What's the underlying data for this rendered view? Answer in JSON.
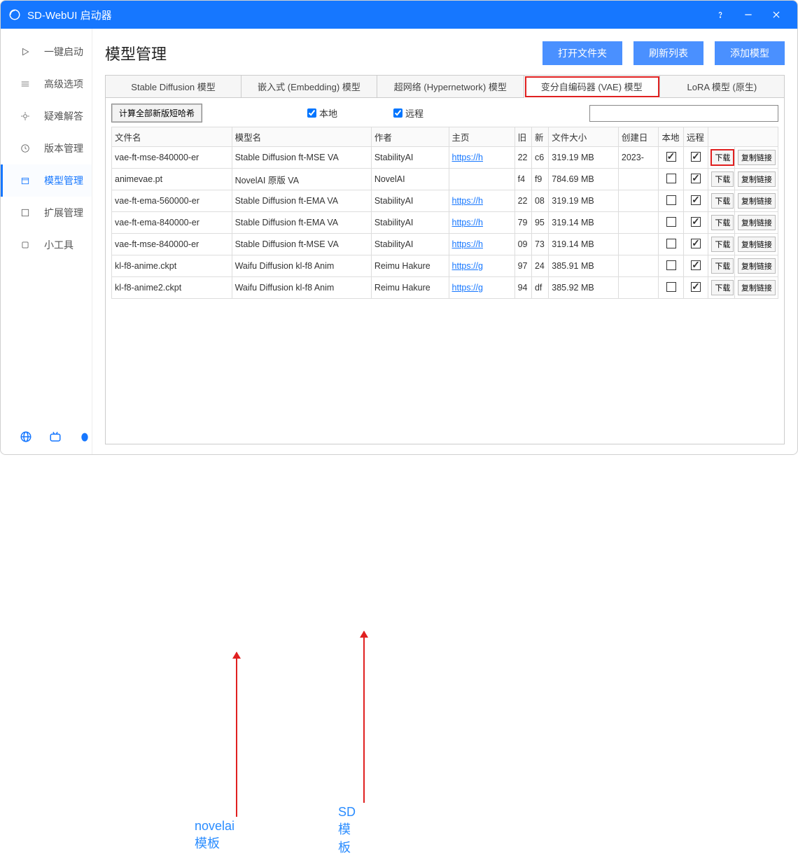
{
  "app": {
    "title": "SD-WebUI 启动器"
  },
  "sidebar": {
    "items": [
      {
        "label": "一键启动"
      },
      {
        "label": "高级选项"
      },
      {
        "label": "疑难解答"
      },
      {
        "label": "版本管理"
      },
      {
        "label": "模型管理"
      },
      {
        "label": "扩展管理"
      },
      {
        "label": "小工具"
      }
    ]
  },
  "header": {
    "title": "模型管理",
    "btn_open": "打开文件夹",
    "btn_refresh": "刷新列表",
    "btn_add": "添加模型"
  },
  "tabs": [
    {
      "label": "Stable Diffusion 模型"
    },
    {
      "label": "嵌入式 (Embedding) 模型"
    },
    {
      "label": "超网络 (Hypernetwork) 模型"
    },
    {
      "label": "变分自编码器 (VAE) 模型"
    },
    {
      "label": "LoRA 模型 (原生)"
    }
  ],
  "toolbar": {
    "hash_btn": "计算全部新版短哈希",
    "local_label": "本地",
    "remote_label": "远程",
    "search_placeholder": ""
  },
  "columns": {
    "filename": "文件名",
    "modelname": "模型名",
    "author": "作者",
    "homepage": "主页",
    "c5": "旧",
    "c6": "新",
    "filesize": "文件大小",
    "created": "创建日",
    "local": "本地",
    "remote": "远程",
    "actions": ""
  },
  "btn_download": "下载",
  "btn_copy": "复制链接",
  "rows": [
    {
      "filename": "vae-ft-mse-840000-er",
      "modelname": "Stable Diffusion ft-MSE VA",
      "author": "StabilityAI",
      "homepage": "https://h",
      "c5": "22",
      "c6": "c6",
      "size": "319.19 MB",
      "created": "2023-",
      "local": true,
      "remote": true,
      "dl_hl": true
    },
    {
      "filename": "animevae.pt",
      "modelname": "NovelAI 原版 VA",
      "author": "NovelAI",
      "homepage": "",
      "c5": "f4",
      "c6": "f9",
      "size": "784.69 MB",
      "created": "",
      "local": false,
      "remote": true,
      "dl_hl": false
    },
    {
      "filename": "vae-ft-ema-560000-er",
      "modelname": "Stable Diffusion ft-EMA VA",
      "author": "StabilityAI",
      "homepage": "https://h",
      "c5": "22",
      "c6": "08",
      "size": "319.19 MB",
      "created": "",
      "local": false,
      "remote": true,
      "dl_hl": false
    },
    {
      "filename": "vae-ft-ema-840000-er",
      "modelname": "Stable Diffusion ft-EMA VA",
      "author": "StabilityAI",
      "homepage": "https://h",
      "c5": "79",
      "c6": "95",
      "size": "319.14 MB",
      "created": "",
      "local": false,
      "remote": true,
      "dl_hl": false
    },
    {
      "filename": "vae-ft-mse-840000-er",
      "modelname": "Stable Diffusion ft-MSE VA",
      "author": "StabilityAI",
      "homepage": "https://h",
      "c5": "09",
      "c6": "73",
      "size": "319.14 MB",
      "created": "",
      "local": false,
      "remote": true,
      "dl_hl": false
    },
    {
      "filename": "kl-f8-anime.ckpt",
      "modelname": "Waifu Diffusion kl-f8 Anim",
      "author": "Reimu Hakure",
      "homepage": "https://g",
      "c5": "97",
      "c6": "24",
      "size": "385.91 MB",
      "created": "",
      "local": false,
      "remote": true,
      "dl_hl": false
    },
    {
      "filename": "kl-f8-anime2.ckpt",
      "modelname": "Waifu Diffusion kl-f8 Anim",
      "author": "Reimu Hakure",
      "homepage": "https://g",
      "c5": "94",
      "c6": "df",
      "size": "385.92 MB",
      "created": "",
      "local": false,
      "remote": true,
      "dl_hl": false
    }
  ],
  "annotations": {
    "novelai": "novelai 模板",
    "sd": "SD模板"
  }
}
